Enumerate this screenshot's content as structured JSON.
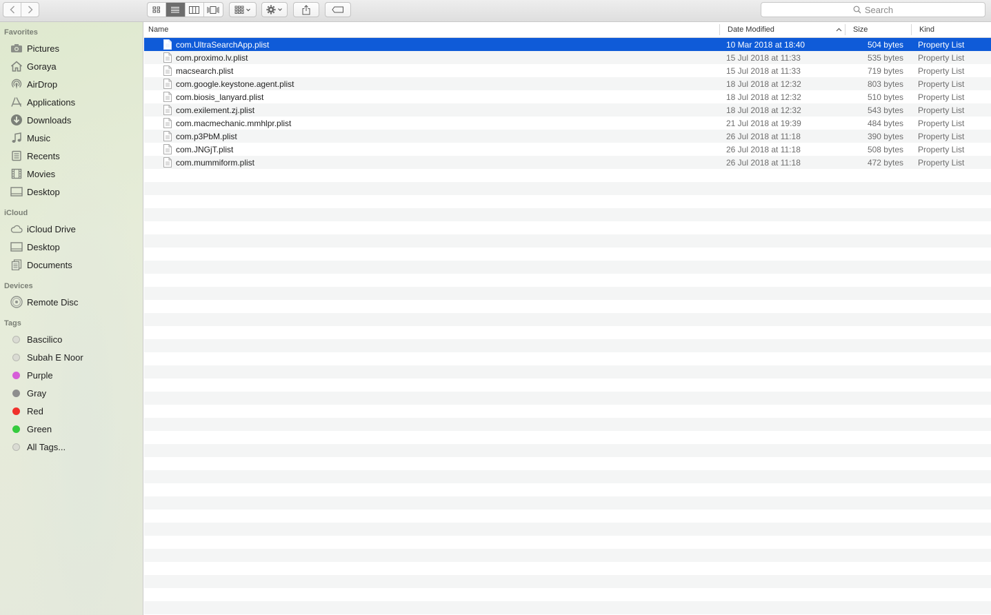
{
  "toolbar": {
    "search_placeholder": "Search",
    "icons": [
      "chevron-left-icon",
      "chevron-right-icon",
      "icon-view-icon",
      "list-view-icon",
      "column-view-icon",
      "cover-flow-icon",
      "arrange-icon",
      "gear-icon",
      "share-icon",
      "tag-icon",
      "search-icon"
    ]
  },
  "sidebar": {
    "favorites_header": "Favorites",
    "favorites": [
      "Pictures",
      "Goraya",
      "AirDrop",
      "Applications",
      "Downloads",
      "Music",
      "Recents",
      "Movies",
      "Desktop"
    ],
    "icloud_header": "iCloud",
    "icloud": [
      "iCloud Drive",
      "Desktop",
      "Documents"
    ],
    "devices_header": "Devices",
    "devices": [
      "Remote Disc"
    ],
    "tags_header": "Tags",
    "tags": [
      {
        "label": "Bascilico",
        "color": "#d9d9d4"
      },
      {
        "label": "Subah E Noor",
        "color": "#d9d9d4"
      },
      {
        "label": "Purple",
        "color": "#d65ed8"
      },
      {
        "label": "Gray",
        "color": "#8e8e8e"
      },
      {
        "label": "Red",
        "color": "#f0312c"
      },
      {
        "label": "Green",
        "color": "#35cb3e"
      },
      {
        "label": "All Tags...",
        "color": "#d9d9d4"
      }
    ]
  },
  "columns": {
    "name": "Name",
    "date": "Date Modified",
    "size": "Size",
    "kind": "Kind"
  },
  "selection_color": "#0f5bd8",
  "files": [
    {
      "name": "com.UltraSearchApp.plist",
      "date": "10 Mar 2018 at 18:40",
      "size": "504 bytes",
      "kind": "Property List"
    },
    {
      "name": "com.proximo.lv.plist",
      "date": "15 Jul 2018 at 11:33",
      "size": "535 bytes",
      "kind": "Property List"
    },
    {
      "name": "macsearch.plist",
      "date": "15 Jul 2018 at 11:33",
      "size": "719 bytes",
      "kind": "Property List"
    },
    {
      "name": "com.google.keystone.agent.plist",
      "date": "18 Jul 2018 at 12:32",
      "size": "803 bytes",
      "kind": "Property List"
    },
    {
      "name": "com.biosis_lanyard.plist",
      "date": "18 Jul 2018 at 12:32",
      "size": "510 bytes",
      "kind": "Property List"
    },
    {
      "name": "com.exilement.zj.plist",
      "date": "18 Jul 2018 at 12:32",
      "size": "543 bytes",
      "kind": "Property List"
    },
    {
      "name": "com.macmechanic.mmhlpr.plist",
      "date": "21 Jul 2018 at 19:39",
      "size": "484 bytes",
      "kind": "Property List"
    },
    {
      "name": "com.p3PbM.plist",
      "date": "26 Jul 2018 at 11:18",
      "size": "390 bytes",
      "kind": "Property List"
    },
    {
      "name": "com.JNGjT.plist",
      "date": "26 Jul 2018 at 11:18",
      "size": "508 bytes",
      "kind": "Property List"
    },
    {
      "name": "com.mummiform.plist",
      "date": "26 Jul 2018 at 11:18",
      "size": "472 bytes",
      "kind": "Property List"
    }
  ]
}
